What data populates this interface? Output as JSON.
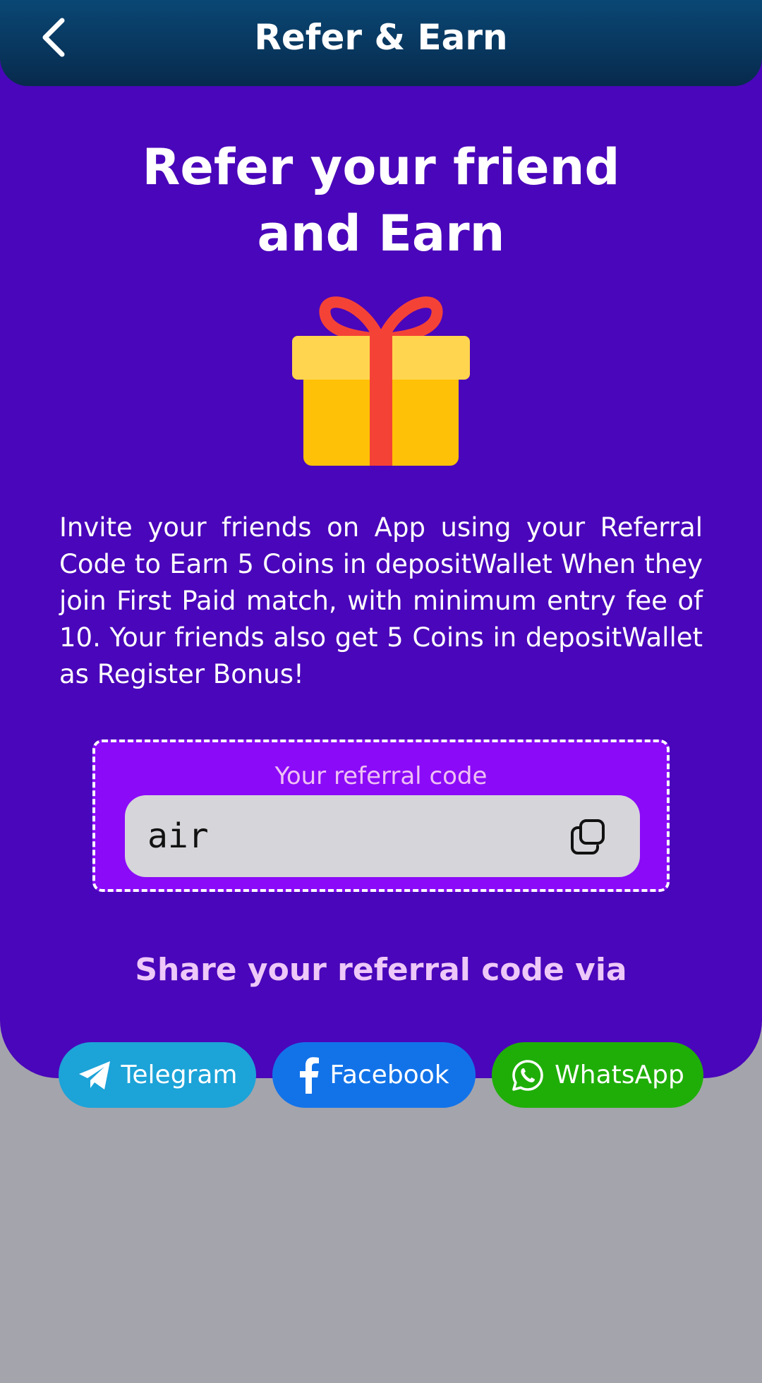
{
  "header": {
    "title": "Refer & Earn",
    "back_icon": "chevron-left-icon"
  },
  "hero": {
    "line1": "Refer your friend",
    "line2": "and Earn",
    "image_icon": "gift-icon"
  },
  "description": "Invite your friends on App using your Referral Code to Earn 5 Coins in depositWallet When they join First Paid match, with minimum entry fee of 10. Your friends also get 5 Coins in depositWallet as Register Bonus!",
  "referral": {
    "label": "Your referral code",
    "code": "air",
    "copy_icon": "copy-icon"
  },
  "share": {
    "heading": "Share your referral code via",
    "buttons": [
      {
        "label": "Telegram",
        "icon": "telegram-icon",
        "color": "#1ca3d8"
      },
      {
        "label": "Facebook",
        "icon": "facebook-icon",
        "color": "#1273e9"
      },
      {
        "label": "WhatsApp",
        "icon": "whatsapp-icon",
        "color": "#1fae08"
      }
    ]
  },
  "colors": {
    "header_bg": "#072a4d",
    "panel_bg": "#4a06ba",
    "code_box_bg": "#8b0bf8",
    "page_bg": "#a4a4ac"
  }
}
